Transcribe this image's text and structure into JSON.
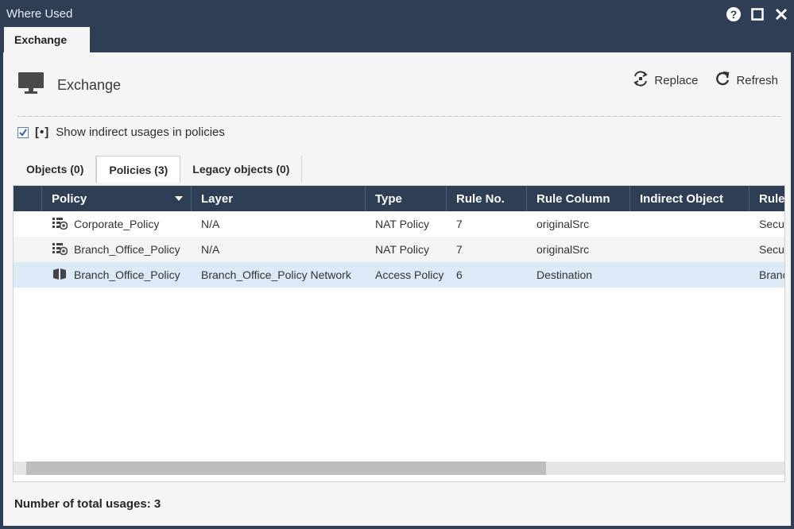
{
  "window": {
    "title": "Where Used"
  },
  "top_tab": {
    "label": "Exchange"
  },
  "object": {
    "name": "Exchange"
  },
  "actions": {
    "replace": "Replace",
    "refresh": "Refresh"
  },
  "indirect": {
    "label": "Show indirect usages in policies",
    "bracket": "[•]",
    "checked": true
  },
  "sub_tabs": [
    "Objects (0)",
    "Policies (3)",
    "Legacy objects (0)"
  ],
  "table": {
    "columns": [
      "Policy",
      "Layer",
      "Type",
      "Rule No.",
      "Rule Column",
      "Indirect Object",
      "Rule"
    ],
    "rows": [
      {
        "icon": "nat-policy-icon",
        "policy": "Corporate_Policy",
        "layer": "N/A",
        "type": "NAT Policy",
        "rule_no": "7",
        "rule_column": "originalSrc",
        "indirect": "",
        "rule": "Secur"
      },
      {
        "icon": "nat-policy-icon",
        "policy": "Branch_Office_Policy",
        "layer": "N/A",
        "type": "NAT Policy",
        "rule_no": "7",
        "rule_column": "originalSrc",
        "indirect": "",
        "rule": "Secur"
      },
      {
        "icon": "access-policy-icon",
        "policy": "Branch_Office_Policy",
        "layer": "Branch_Office_Policy Network",
        "type": "Access Policy",
        "rule_no": "6",
        "rule_column": "Destination",
        "indirect": "",
        "rule": "Branc"
      }
    ]
  },
  "footer": {
    "label": "Number of total usages: 3"
  },
  "colors": {
    "chrome": "#2d3e55",
    "selected_row": "#dce9f7",
    "panel": "#f5f5f5"
  }
}
